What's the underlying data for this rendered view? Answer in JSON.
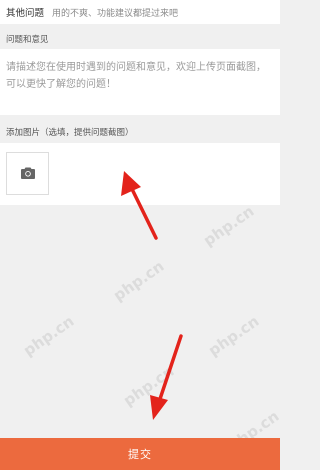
{
  "other_issues": {
    "title": "其他问题",
    "hint": "用的不爽、功能建议都提过来吧"
  },
  "feedback": {
    "label": "问题和意见",
    "placeholder": "请描述您在使用时遇到的问题和意见，欢迎上传页面截图，可以更快了解您的问题！"
  },
  "images": {
    "label": "添加图片（选填，提供问题截图）",
    "add_icon": "camera-icon"
  },
  "submit": {
    "label": "提交"
  },
  "watermark": "php.cn",
  "colors": {
    "accent": "#ec6a3e",
    "arrow": "#e3231b",
    "background": "#f0f0f0"
  }
}
